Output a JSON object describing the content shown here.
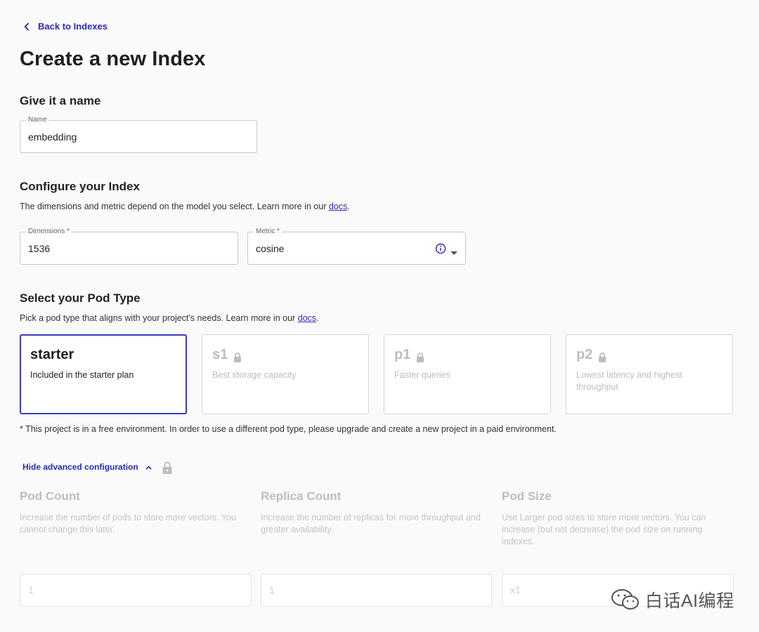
{
  "nav": {
    "back_label": "Back to Indexes"
  },
  "page": {
    "title": "Create a new Index"
  },
  "name_section": {
    "title": "Give it a name",
    "field_label": "Name",
    "field_value": "embedding"
  },
  "config_section": {
    "title": "Configure your Index",
    "desc_text": "The dimensions and metric depend on the model you select. Learn more in our ",
    "desc_link": "docs",
    "desc_end": ".",
    "dimensions_label": "Dimensions *",
    "dimensions_value": "1536",
    "metric_label": "Metric *",
    "metric_value": "cosine"
  },
  "pod_section": {
    "title": "Select your Pod Type",
    "desc_text": "Pick a pod type that aligns with your project's needs. Learn more in our ",
    "desc_link": "docs",
    "desc_end": ".",
    "cards": [
      {
        "name": "starter",
        "desc": "Included in the starter plan",
        "selected": true,
        "locked": false
      },
      {
        "name": "s1",
        "desc": "Best storage capacity",
        "selected": false,
        "locked": true
      },
      {
        "name": "p1",
        "desc": "Faster queries",
        "selected": false,
        "locked": true
      },
      {
        "name": "p2",
        "desc": "Lowest latency and highest throughput",
        "selected": false,
        "locked": true
      }
    ],
    "footnote": "* This project is in a free environment. In order to use a different pod type, please upgrade and create a new project in a paid environment."
  },
  "advanced": {
    "toggle_label": "Hide advanced configuration",
    "columns": [
      {
        "title": "Pod Count",
        "desc": "Increase the number of pods to store more vectors. You cannot change this later.",
        "placeholder": "1"
      },
      {
        "title": "Replica Count",
        "desc": "Increase the number of replicas for more throughput and greater availability.",
        "placeholder": "1"
      },
      {
        "title": "Pod Size",
        "desc": "Use Larger pod sizes to store more vectors. You can increase (but not decrease) the pod size on running indexes.",
        "placeholder": "x1"
      }
    ]
  },
  "watermark": {
    "text": "白话AI编程"
  },
  "colors": {
    "accent": "#2a2ab5",
    "selected_border": "#3a3ac0",
    "disabled_text": "#bdbdbd"
  }
}
